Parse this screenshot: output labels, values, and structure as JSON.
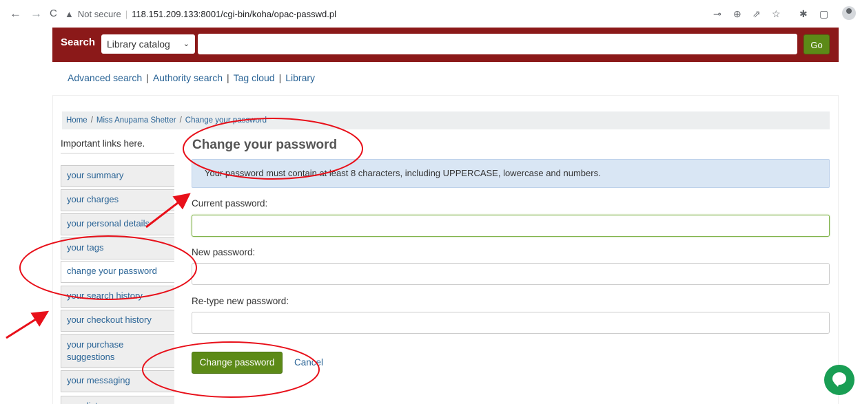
{
  "browser": {
    "back": "←",
    "forward": "→",
    "reload": "C",
    "warning": "▲",
    "not_secure": "Not secure",
    "url": "118.151.209.133:8001/cgi-bin/koha/opac-passwd.pl"
  },
  "search": {
    "label": "Search",
    "select_value": "Library catalog",
    "go_label": "Go"
  },
  "links": [
    "Advanced search",
    "Authority search",
    "Tag cloud",
    "Library"
  ],
  "breadcrumb": [
    "Home",
    "Miss Anupama Shetter",
    "Change your password"
  ],
  "sidebar": {
    "heading": "Important links here.",
    "items": [
      {
        "label": "your summary"
      },
      {
        "label": "your charges"
      },
      {
        "label": "your personal details"
      },
      {
        "label": "your tags"
      },
      {
        "label": "change your password"
      },
      {
        "label": "your search history"
      },
      {
        "label": "your checkout history"
      },
      {
        "label": "your purchase suggestions"
      },
      {
        "label": "your messaging"
      },
      {
        "label": "your lists"
      }
    ]
  },
  "main": {
    "title": "Change your password",
    "alert": "Your password must contain at least 8 characters, including UPPERCASE, lowercase and numbers.",
    "current_label": "Current password:",
    "new_label": "New password:",
    "retype_label": "Re-type new password:",
    "submit_label": "Change password",
    "cancel_label": "Cancel"
  },
  "colors": {
    "brand_red": "#8b1919",
    "button_green": "#5c8a17",
    "link_blue": "#2a6496",
    "annotation_red": "#e8101a",
    "chat_green": "#199e54"
  },
  "icons": [
    "back-icon",
    "forward-icon",
    "reload-icon",
    "warning-icon",
    "key-icon",
    "zoom-icon",
    "share-icon",
    "star-icon",
    "extensions-icon",
    "sidepanel-icon",
    "profile-icon",
    "chat-icon"
  ]
}
